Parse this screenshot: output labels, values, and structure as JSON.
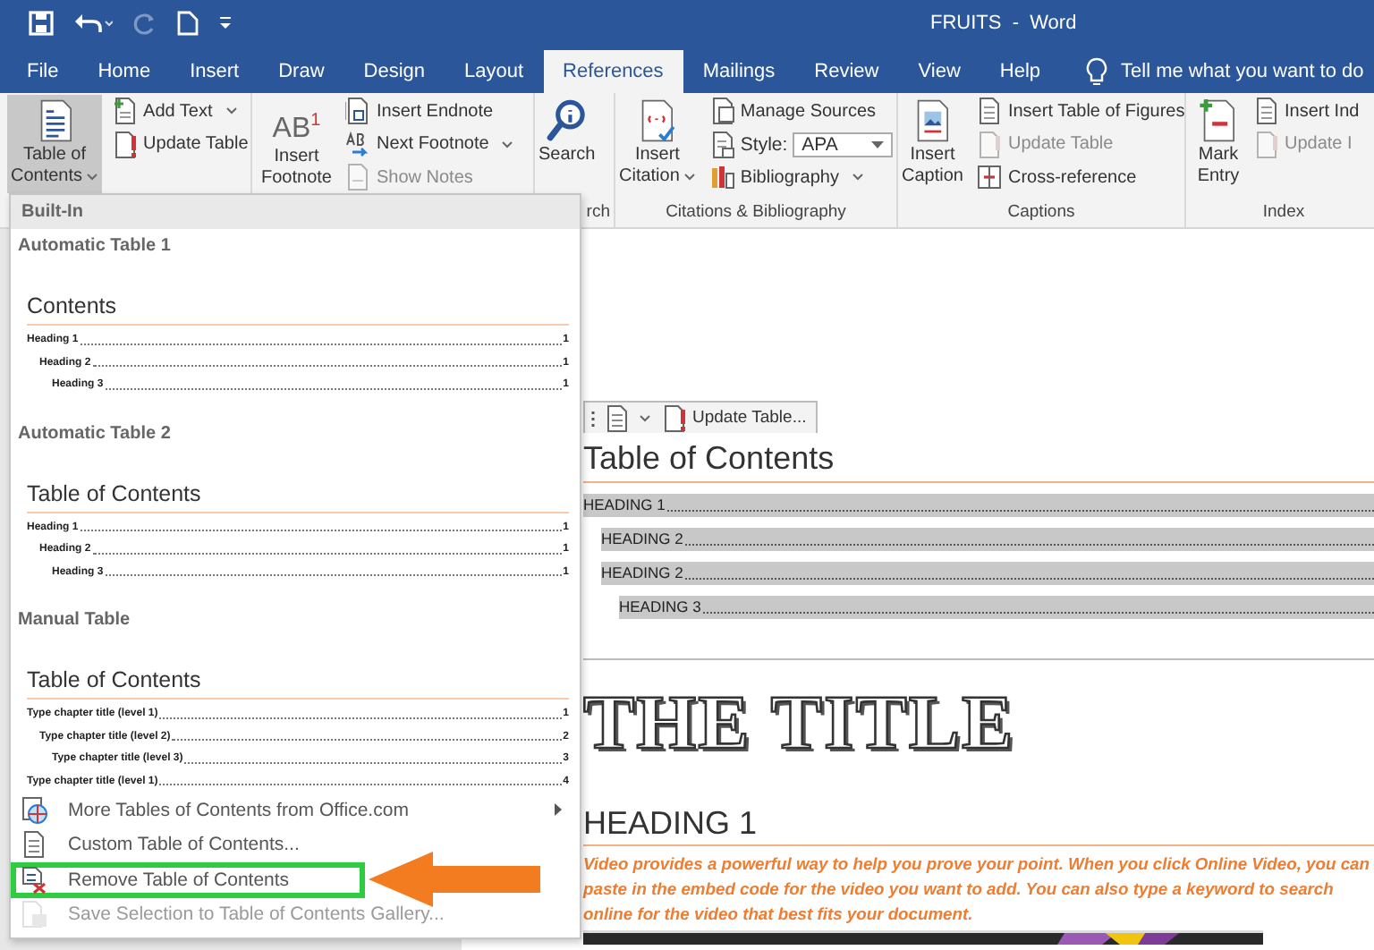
{
  "window": {
    "title": "FRUITS  -  Word"
  },
  "tabs": [
    {
      "label": "File",
      "selected": false
    },
    {
      "label": "Home",
      "selected": false
    },
    {
      "label": "Insert",
      "selected": false
    },
    {
      "label": "Draw",
      "selected": false
    },
    {
      "label": "Design",
      "selected": false
    },
    {
      "label": "Layout",
      "selected": false
    },
    {
      "label": "References",
      "selected": true
    },
    {
      "label": "Mailings",
      "selected": false
    },
    {
      "label": "Review",
      "selected": false
    },
    {
      "label": "View",
      "selected": false
    },
    {
      "label": "Help",
      "selected": false
    }
  ],
  "tell_me": {
    "placeholder": "Tell me what you want to do"
  },
  "ribbon": [
    {
      "large": {
        "lines": [
          "Table of",
          "Contents"
        ],
        "caret": true,
        "pressed": true
      },
      "small": [
        {
          "kind": "button",
          "label": "Add Text",
          "caret": true,
          "disabled": false
        },
        {
          "kind": "button",
          "label": "Update Table",
          "caret": false,
          "disabled": false
        }
      ]
    },
    {
      "large": {
        "lines": [
          "Insert",
          "Footnote"
        ],
        "caret": false,
        "pressed": false,
        "icon_text": "AB$^{1}$"
      },
      "small": [
        {
          "kind": "button",
          "label": "Insert Endnote",
          "caret": false,
          "disabled": false
        },
        {
          "kind": "button",
          "label": "Next Footnote",
          "caret": true,
          "disabled": false
        },
        {
          "kind": "button",
          "label": "Show Notes",
          "caret": false,
          "disabled": true
        }
      ]
    },
    {
      "large": {
        "lines": [
          "Search"
        ],
        "caret": false,
        "pressed": false
      },
      "group_label": "rch"
    },
    {
      "large": {
        "lines": [
          "Insert",
          "Citation"
        ],
        "caret": true,
        "pressed": false
      },
      "small": [
        {
          "kind": "button",
          "label": "Manage Sources",
          "caret": false,
          "disabled": false
        },
        {
          "kind": "select",
          "label": "Style:",
          "value": "APA",
          "caret": true,
          "disabled": false
        },
        {
          "kind": "button",
          "label": "Bibliography",
          "caret": true,
          "disabled": false
        }
      ],
      "group_label": "Citations & Bibliography"
    },
    {
      "large": {
        "lines": [
          "Insert",
          "Caption"
        ],
        "caret": false,
        "pressed": false
      },
      "small": [
        {
          "kind": "button",
          "label": "Insert Table of Figures",
          "caret": false,
          "disabled": false
        },
        {
          "kind": "button",
          "label": "Update Table",
          "caret": false,
          "disabled": true
        },
        {
          "kind": "button",
          "label": "Cross-reference",
          "caret": false,
          "disabled": false
        }
      ],
      "group_label": "Captions"
    },
    {
      "large": {
        "lines": [
          "Mark",
          "Entry"
        ],
        "caret": false,
        "pressed": false
      },
      "small": [
        {
          "kind": "button",
          "label": "Insert Ind",
          "caret": false,
          "disabled": false
        },
        {
          "kind": "button",
          "label": "Update I",
          "caret": false,
          "disabled": true
        }
      ],
      "group_label": "Index"
    }
  ],
  "toc_menu": {
    "header": "Built-In",
    "gallery": [
      {
        "title": "Automatic Table 1",
        "preview_heading": "Contents",
        "entries": [
          {
            "text": "Heading 1",
            "page": "1",
            "children": [
              {
                "text": "Heading 2",
                "page": "1",
                "children": [
                  {
                    "text": "Heading 3",
                    "page": "1"
                  }
                ]
              }
            ]
          }
        ]
      },
      {
        "title": "Automatic Table 2",
        "preview_heading": "Table of Contents",
        "entries": [
          {
            "text": "Heading 1",
            "page": "1",
            "children": [
              {
                "text": "Heading 2",
                "page": "1",
                "children": [
                  {
                    "text": "Heading 3",
                    "page": "1"
                  }
                ]
              }
            ]
          }
        ]
      },
      {
        "title": "Manual Table",
        "preview_heading": "Table of Contents",
        "entries": [
          {
            "text": "Type chapter title (level 1)",
            "page": "1",
            "children": [
              {
                "text": "Type chapter title (level 2)",
                "page": "2",
                "children": [
                  {
                    "text": "Type chapter title (level 3)",
                    "page": "3"
                  }
                ]
              }
            ]
          },
          {
            "text": "Type chapter title (level 1)",
            "page": "4"
          }
        ]
      }
    ],
    "commands": [
      {
        "label": "More Tables of Contents from Office.com",
        "submenu": true,
        "disabled": false,
        "highlighted": false
      },
      {
        "label": "Custom Table of Contents...",
        "submenu": false,
        "disabled": false,
        "highlighted": false
      },
      {
        "label": "Remove Table of Contents",
        "submenu": false,
        "disabled": false,
        "highlighted": true
      },
      {
        "label": "Save Selection to Table of Contents Gallery...",
        "submenu": false,
        "disabled": true,
        "highlighted": false
      }
    ]
  },
  "document": {
    "content_control": {
      "label": "Update Table..."
    },
    "toc_title": "Table of Contents",
    "toc_entries": [
      {
        "text": "HEADING 1",
        "children": [
          {
            "text": "HEADING 2"
          },
          {
            "text": "HEADING 2",
            "children": [
              {
                "text": "HEADING 3"
              }
            ]
          }
        ]
      }
    ],
    "title": "THE TITLE",
    "heading": "HEADING 1",
    "paragraph": "Video provides a powerful way to help you prove your point. When you click Online Video, you can paste in the embed code for the video you want to add. You can also type a keyword to search online for the video that best fits your document."
  }
}
